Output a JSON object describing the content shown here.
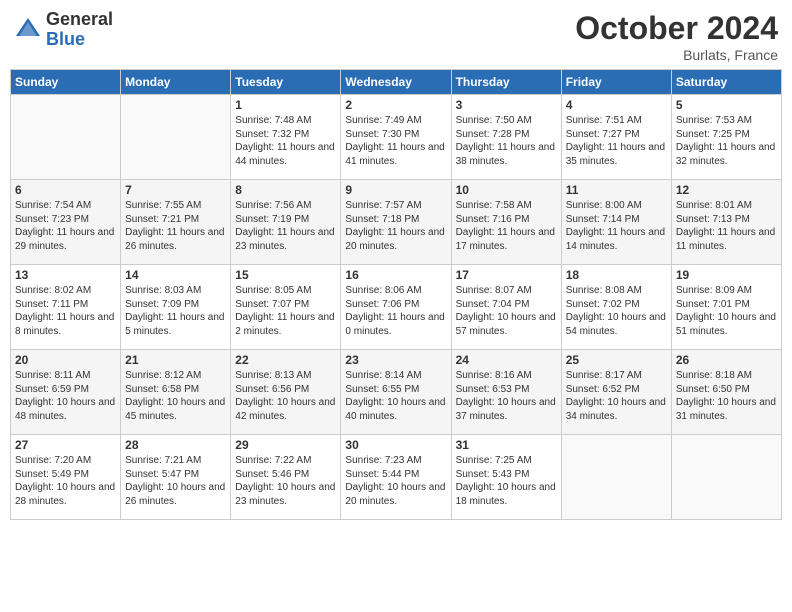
{
  "header": {
    "logo_general": "General",
    "logo_blue": "Blue",
    "month_title": "October 2024",
    "location": "Burlats, France"
  },
  "days_of_week": [
    "Sunday",
    "Monday",
    "Tuesday",
    "Wednesday",
    "Thursday",
    "Friday",
    "Saturday"
  ],
  "weeks": [
    [
      {
        "day": "",
        "sunrise": "",
        "sunset": "",
        "daylight": ""
      },
      {
        "day": "",
        "sunrise": "",
        "sunset": "",
        "daylight": ""
      },
      {
        "day": "1",
        "sunrise": "Sunrise: 7:48 AM",
        "sunset": "Sunset: 7:32 PM",
        "daylight": "Daylight: 11 hours and 44 minutes."
      },
      {
        "day": "2",
        "sunrise": "Sunrise: 7:49 AM",
        "sunset": "Sunset: 7:30 PM",
        "daylight": "Daylight: 11 hours and 41 minutes."
      },
      {
        "day": "3",
        "sunrise": "Sunrise: 7:50 AM",
        "sunset": "Sunset: 7:28 PM",
        "daylight": "Daylight: 11 hours and 38 minutes."
      },
      {
        "day": "4",
        "sunrise": "Sunrise: 7:51 AM",
        "sunset": "Sunset: 7:27 PM",
        "daylight": "Daylight: 11 hours and 35 minutes."
      },
      {
        "day": "5",
        "sunrise": "Sunrise: 7:53 AM",
        "sunset": "Sunset: 7:25 PM",
        "daylight": "Daylight: 11 hours and 32 minutes."
      }
    ],
    [
      {
        "day": "6",
        "sunrise": "Sunrise: 7:54 AM",
        "sunset": "Sunset: 7:23 PM",
        "daylight": "Daylight: 11 hours and 29 minutes."
      },
      {
        "day": "7",
        "sunrise": "Sunrise: 7:55 AM",
        "sunset": "Sunset: 7:21 PM",
        "daylight": "Daylight: 11 hours and 26 minutes."
      },
      {
        "day": "8",
        "sunrise": "Sunrise: 7:56 AM",
        "sunset": "Sunset: 7:19 PM",
        "daylight": "Daylight: 11 hours and 23 minutes."
      },
      {
        "day": "9",
        "sunrise": "Sunrise: 7:57 AM",
        "sunset": "Sunset: 7:18 PM",
        "daylight": "Daylight: 11 hours and 20 minutes."
      },
      {
        "day": "10",
        "sunrise": "Sunrise: 7:58 AM",
        "sunset": "Sunset: 7:16 PM",
        "daylight": "Daylight: 11 hours and 17 minutes."
      },
      {
        "day": "11",
        "sunrise": "Sunrise: 8:00 AM",
        "sunset": "Sunset: 7:14 PM",
        "daylight": "Daylight: 11 hours and 14 minutes."
      },
      {
        "day": "12",
        "sunrise": "Sunrise: 8:01 AM",
        "sunset": "Sunset: 7:13 PM",
        "daylight": "Daylight: 11 hours and 11 minutes."
      }
    ],
    [
      {
        "day": "13",
        "sunrise": "Sunrise: 8:02 AM",
        "sunset": "Sunset: 7:11 PM",
        "daylight": "Daylight: 11 hours and 8 minutes."
      },
      {
        "day": "14",
        "sunrise": "Sunrise: 8:03 AM",
        "sunset": "Sunset: 7:09 PM",
        "daylight": "Daylight: 11 hours and 5 minutes."
      },
      {
        "day": "15",
        "sunrise": "Sunrise: 8:05 AM",
        "sunset": "Sunset: 7:07 PM",
        "daylight": "Daylight: 11 hours and 2 minutes."
      },
      {
        "day": "16",
        "sunrise": "Sunrise: 8:06 AM",
        "sunset": "Sunset: 7:06 PM",
        "daylight": "Daylight: 11 hours and 0 minutes."
      },
      {
        "day": "17",
        "sunrise": "Sunrise: 8:07 AM",
        "sunset": "Sunset: 7:04 PM",
        "daylight": "Daylight: 10 hours and 57 minutes."
      },
      {
        "day": "18",
        "sunrise": "Sunrise: 8:08 AM",
        "sunset": "Sunset: 7:02 PM",
        "daylight": "Daylight: 10 hours and 54 minutes."
      },
      {
        "day": "19",
        "sunrise": "Sunrise: 8:09 AM",
        "sunset": "Sunset: 7:01 PM",
        "daylight": "Daylight: 10 hours and 51 minutes."
      }
    ],
    [
      {
        "day": "20",
        "sunrise": "Sunrise: 8:11 AM",
        "sunset": "Sunset: 6:59 PM",
        "daylight": "Daylight: 10 hours and 48 minutes."
      },
      {
        "day": "21",
        "sunrise": "Sunrise: 8:12 AM",
        "sunset": "Sunset: 6:58 PM",
        "daylight": "Daylight: 10 hours and 45 minutes."
      },
      {
        "day": "22",
        "sunrise": "Sunrise: 8:13 AM",
        "sunset": "Sunset: 6:56 PM",
        "daylight": "Daylight: 10 hours and 42 minutes."
      },
      {
        "day": "23",
        "sunrise": "Sunrise: 8:14 AM",
        "sunset": "Sunset: 6:55 PM",
        "daylight": "Daylight: 10 hours and 40 minutes."
      },
      {
        "day": "24",
        "sunrise": "Sunrise: 8:16 AM",
        "sunset": "Sunset: 6:53 PM",
        "daylight": "Daylight: 10 hours and 37 minutes."
      },
      {
        "day": "25",
        "sunrise": "Sunrise: 8:17 AM",
        "sunset": "Sunset: 6:52 PM",
        "daylight": "Daylight: 10 hours and 34 minutes."
      },
      {
        "day": "26",
        "sunrise": "Sunrise: 8:18 AM",
        "sunset": "Sunset: 6:50 PM",
        "daylight": "Daylight: 10 hours and 31 minutes."
      }
    ],
    [
      {
        "day": "27",
        "sunrise": "Sunrise: 7:20 AM",
        "sunset": "Sunset: 5:49 PM",
        "daylight": "Daylight: 10 hours and 28 minutes."
      },
      {
        "day": "28",
        "sunrise": "Sunrise: 7:21 AM",
        "sunset": "Sunset: 5:47 PM",
        "daylight": "Daylight: 10 hours and 26 minutes."
      },
      {
        "day": "29",
        "sunrise": "Sunrise: 7:22 AM",
        "sunset": "Sunset: 5:46 PM",
        "daylight": "Daylight: 10 hours and 23 minutes."
      },
      {
        "day": "30",
        "sunrise": "Sunrise: 7:23 AM",
        "sunset": "Sunset: 5:44 PM",
        "daylight": "Daylight: 10 hours and 20 minutes."
      },
      {
        "day": "31",
        "sunrise": "Sunrise: 7:25 AM",
        "sunset": "Sunset: 5:43 PM",
        "daylight": "Daylight: 10 hours and 18 minutes."
      },
      {
        "day": "",
        "sunrise": "",
        "sunset": "",
        "daylight": ""
      },
      {
        "day": "",
        "sunrise": "",
        "sunset": "",
        "daylight": ""
      }
    ]
  ]
}
